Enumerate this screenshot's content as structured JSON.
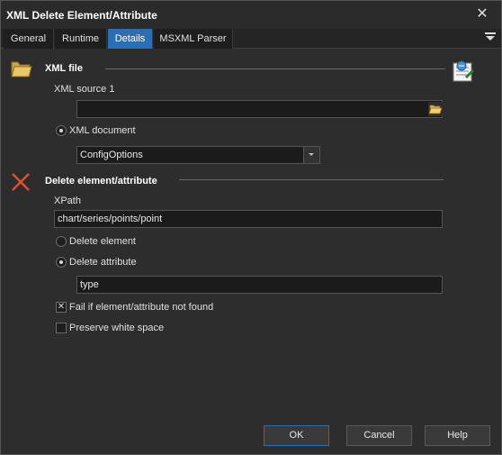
{
  "window": {
    "title": "XML Delete Element/Attribute"
  },
  "tabs": [
    {
      "label": "General"
    },
    {
      "label": "Runtime"
    },
    {
      "label": "Details"
    },
    {
      "label": "MSXML Parser"
    }
  ],
  "active_tab": "Details",
  "xml_file": {
    "section_title": "XML file",
    "source_label": "XML source 1",
    "source_value": "",
    "xml_document_label": "XML document",
    "xml_document_selected": true,
    "document_combo_value": "ConfigOptions"
  },
  "delete_section": {
    "section_title": "Delete element/attribute",
    "xpath_label": "XPath",
    "xpath_value": "chart/series/points/point",
    "delete_element_label": "Delete element",
    "delete_element_selected": false,
    "delete_attribute_label": "Delete attribute",
    "delete_attribute_selected": true,
    "attribute_value": "type",
    "fail_if_not_found_label": "Fail if element/attribute not found",
    "fail_if_not_found_checked": true,
    "preserve_whitespace_label": "Preserve white space",
    "preserve_whitespace_checked": false
  },
  "footer": {
    "ok_label": "OK",
    "cancel_label": "Cancel",
    "help_label": "Help"
  },
  "colors": {
    "accent": "#2f6db3",
    "background": "#2d2d2d",
    "delete_icon": "#e0502e"
  },
  "icons": [
    "close-icon",
    "menu-icon",
    "folder-icon",
    "wizard-icon",
    "delete-icon",
    "browse-folder-icon",
    "dropdown-arrow-icon",
    "check-icon"
  ]
}
